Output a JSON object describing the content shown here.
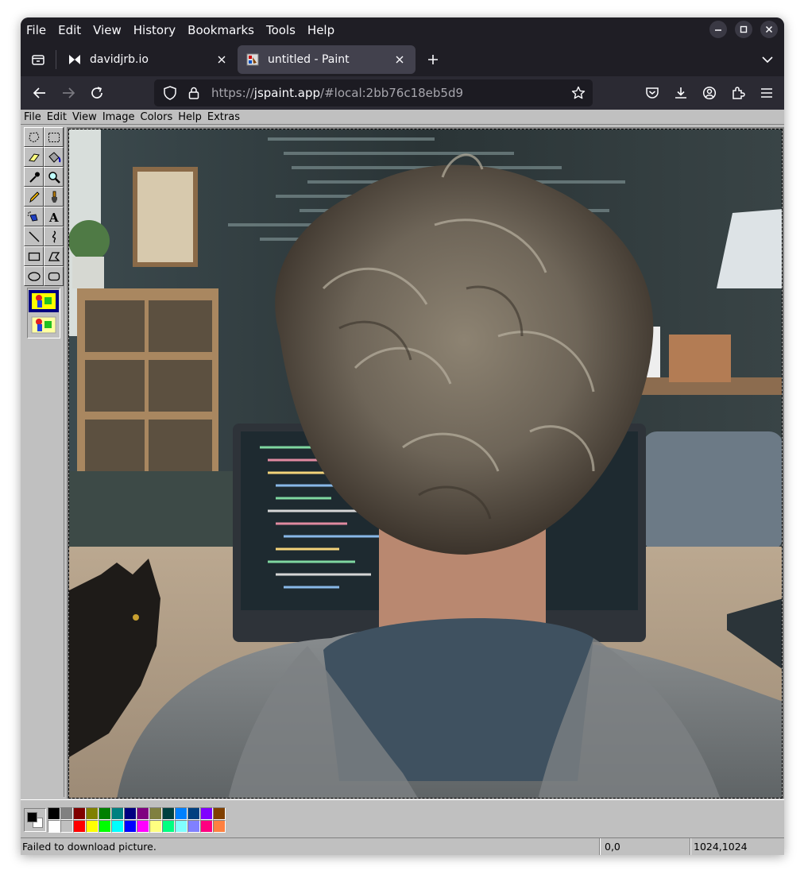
{
  "browser": {
    "menu": [
      "File",
      "Edit",
      "View",
      "History",
      "Bookmarks",
      "Tools",
      "Help"
    ],
    "tabs": [
      {
        "title": "davidjrb.io",
        "active": false
      },
      {
        "title": "untitled - Paint",
        "active": true
      }
    ],
    "url": {
      "scheme": "https://",
      "host": "jspaint.app",
      "path": "/#local:2bb76c18eb5d9"
    }
  },
  "paint": {
    "menu": [
      "File",
      "Edit",
      "View",
      "Image",
      "Colors",
      "Help",
      "Extras"
    ],
    "tools": [
      "free-form-select",
      "rectangle-select",
      "eraser",
      "fill-with-color",
      "pick-color",
      "magnifier",
      "pencil",
      "brush",
      "airbrush",
      "text",
      "line",
      "curve",
      "rectangle",
      "polygon",
      "ellipse",
      "rounded-rectangle"
    ],
    "palette": [
      "#000000",
      "#808080",
      "#800000",
      "#808000",
      "#008000",
      "#008080",
      "#000080",
      "#800080",
      "#808040",
      "#004040",
      "#0080ff",
      "#004080",
      "#8000ff",
      "#804000",
      "#ffffff",
      "#c0c0c0",
      "#ff0000",
      "#ffff00",
      "#00ff00",
      "#00ffff",
      "#0000ff",
      "#ff00ff",
      "#ffff80",
      "#00ff80",
      "#80ffff",
      "#8080ff",
      "#ff0080",
      "#ff8040"
    ],
    "colors": {
      "foreground": "#000000",
      "background": "#ffffff"
    },
    "status": {
      "message": "Failed to download picture.",
      "position": "0,0",
      "size": "1024,1024"
    }
  }
}
